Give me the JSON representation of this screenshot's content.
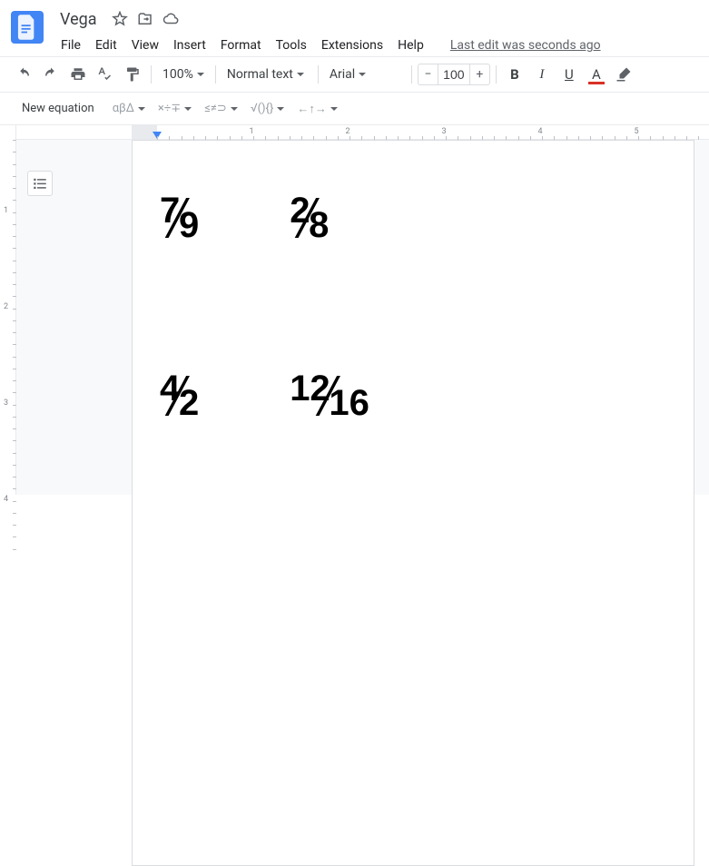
{
  "header": {
    "title": "Vega",
    "last_edit": "Last edit was seconds ago"
  },
  "menubar": {
    "file": "File",
    "edit": "Edit",
    "view": "View",
    "insert": "Insert",
    "format": "Format",
    "tools": "Tools",
    "extensions": "Extensions",
    "help": "Help"
  },
  "toolbar": {
    "zoom": "100%",
    "style": "Normal text",
    "font": "Arial",
    "font_size": "100"
  },
  "eq_toolbar": {
    "new_equation": "New equation",
    "greek": "αβΔ",
    "ops": "×÷∓",
    "rel": "≤≠⊃",
    "sqrt": "√(){}",
    "arrows": "←↑→"
  },
  "ruler": {
    "h": [
      "1",
      "2",
      "3",
      "4",
      "5"
    ],
    "v": [
      "1",
      "2",
      "3",
      "4"
    ]
  },
  "document": {
    "fractions": [
      [
        {
          "num": "7",
          "den": "9"
        },
        {
          "num": "2",
          "den": "8"
        }
      ],
      [
        {
          "num": "4",
          "den": "2"
        },
        {
          "num": "12",
          "den": "16"
        }
      ]
    ]
  }
}
